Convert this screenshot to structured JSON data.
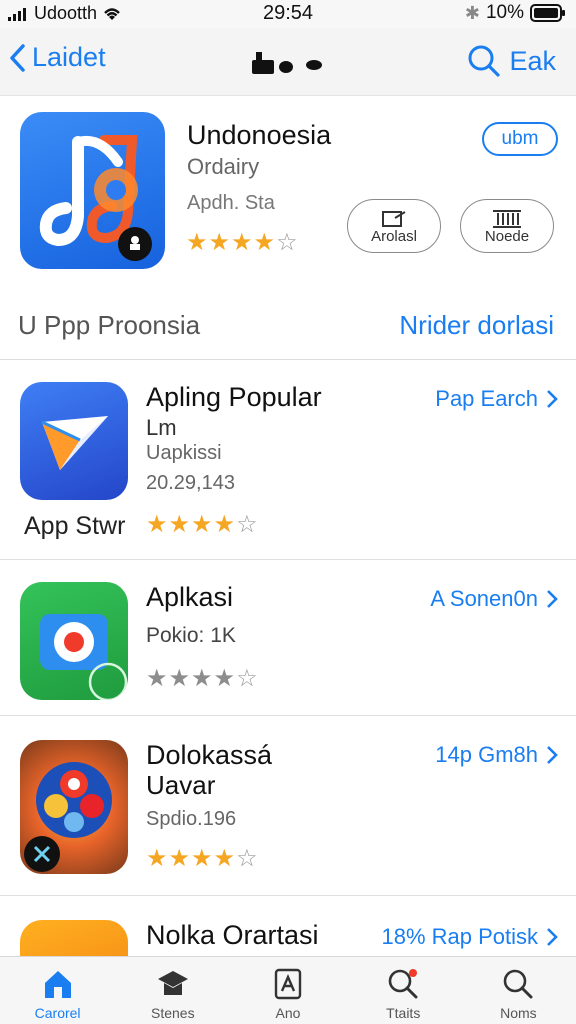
{
  "status_bar": {
    "carrier": "Udootth",
    "time": "29:54",
    "battery": "10%"
  },
  "nav": {
    "back_label": "Laidet",
    "search_label": "Eak"
  },
  "featured": {
    "name": "Undonoesia",
    "category": "Ordairy",
    "developer": "Apdh. Sta",
    "rating": 4,
    "get_label": "ubm",
    "button_a_label": "Arolasl",
    "button_b_label": "Noede"
  },
  "section": {
    "title": "U Ppp Proonsia",
    "link": "Nrider dorlasi"
  },
  "apps": [
    {
      "name": "Apling Popular",
      "line2": "Lm",
      "line3": "Uapkissi",
      "line4": "20.29,143",
      "rating": 4,
      "action": "Pap Earch",
      "caption": "App Stwr"
    },
    {
      "name": "Aplkasi",
      "line2": "Pokio: 1K",
      "rating": 4,
      "action": "A Sonen0n"
    },
    {
      "name": "Dolokassá",
      "line2": "Uavar",
      "line3": "Spdio.196",
      "rating": 4,
      "action": "14p Gm8h"
    },
    {
      "name": "Nolka Orartasi",
      "action": "18% Rap Potisk"
    }
  ],
  "tabs": [
    {
      "label": "Carorel",
      "icon": "home-icon"
    },
    {
      "label": "Stenes",
      "icon": "cap-icon"
    },
    {
      "label": "Ano",
      "icon": "app-icon"
    },
    {
      "label": "Ttaits",
      "icon": "search-icon"
    },
    {
      "label": "Noms",
      "icon": "search-icon"
    }
  ],
  "colors": {
    "accent": "#1a7ef0",
    "star": "#f5a623"
  }
}
